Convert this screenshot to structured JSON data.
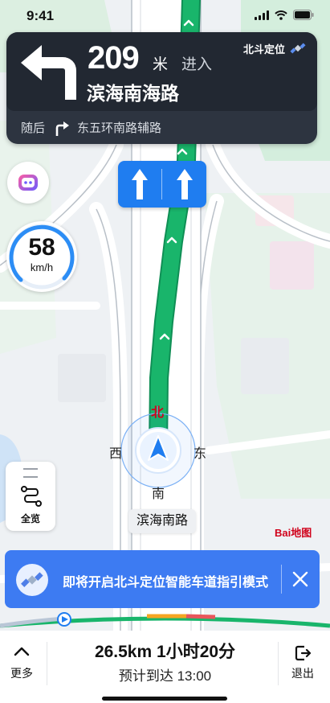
{
  "status_bar": {
    "time": "9:41"
  },
  "guidance": {
    "distance": "209",
    "distance_unit": "米",
    "action": "进入",
    "road": "滨海南海路",
    "beidou_label": "北斗定位",
    "next_label": "随后",
    "next_road": "东五环南路辅路"
  },
  "speed": {
    "value": "58",
    "unit": "km/h"
  },
  "compass": {
    "north": "北",
    "south": "南",
    "east": "东",
    "west": "西"
  },
  "side_panel": {
    "overview_label": "全览"
  },
  "current_road": "滨海南路",
  "map_logo": "Bai地图",
  "banner": {
    "text": "即将开启北斗定位智能车道指引模式"
  },
  "trip": {
    "distance": "26.5km",
    "duration": "1小时20分",
    "eta_label": "预计到达",
    "eta_time": "13:00"
  },
  "bottom": {
    "more_label": "更多",
    "exit_label": "退出"
  },
  "colors": {
    "route": "#19b56b",
    "accent": "#1f7df0",
    "banner": "#3d7bf2",
    "card": "#222832"
  }
}
